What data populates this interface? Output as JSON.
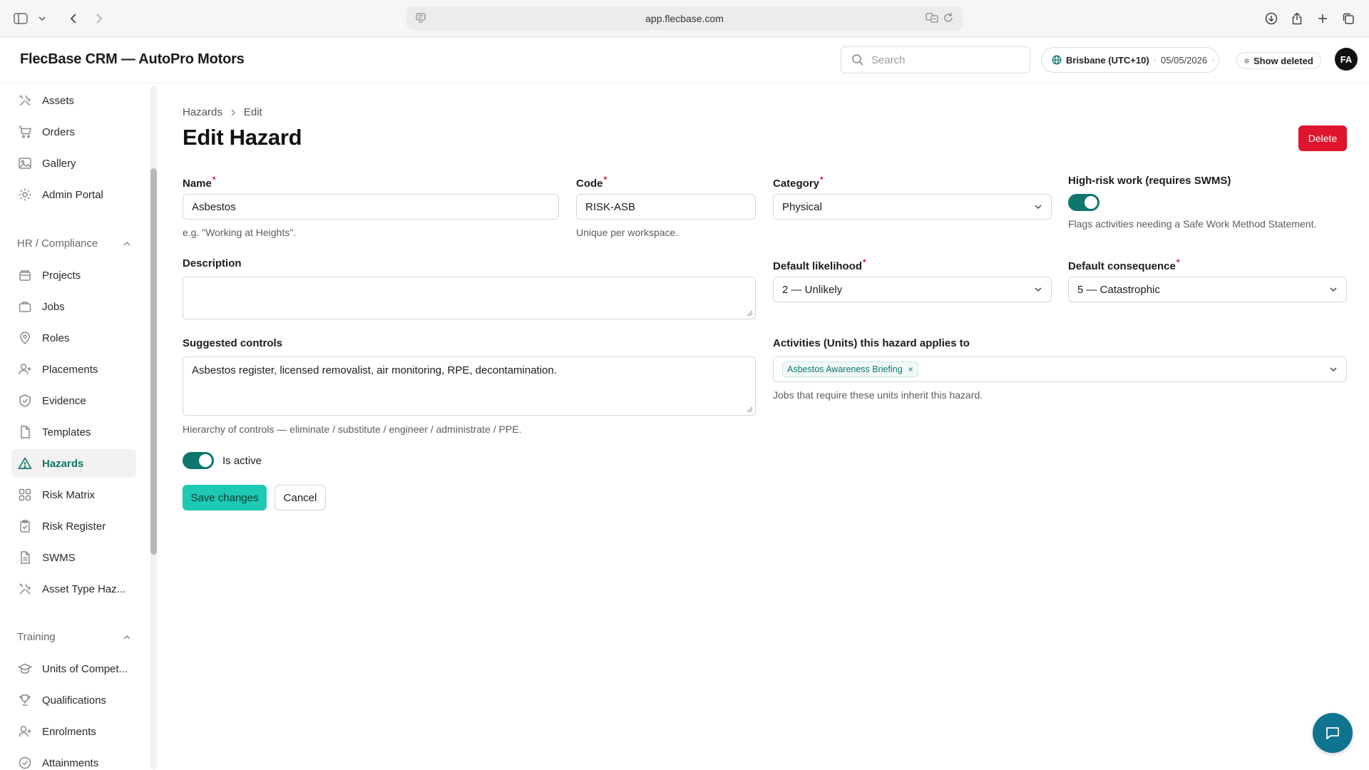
{
  "browser": {
    "url": "app.flecbase.com"
  },
  "header": {
    "app_title": "FlecBase CRM — AutoPro Motors",
    "search_placeholder": "Search",
    "timezone": "Brisbane (UTC+10)",
    "date": "05/05/2026",
    "show_deleted_label": "Show deleted",
    "avatar_initials": "FA"
  },
  "sidebar": {
    "top_items": [
      {
        "label": "Assets",
        "icon": "tools-icon"
      },
      {
        "label": "Orders",
        "icon": "cart-icon"
      },
      {
        "label": "Gallery",
        "icon": "image-icon"
      },
      {
        "label": "Admin Portal",
        "icon": "gear-icon"
      }
    ],
    "hr_group_label": "HR / Compliance",
    "hr_items": [
      {
        "label": "Projects",
        "icon": "folder-icon"
      },
      {
        "label": "Jobs",
        "icon": "briefcase-icon"
      },
      {
        "label": "Roles",
        "icon": "location-pin-icon"
      },
      {
        "label": "Placements",
        "icon": "user-plus-icon"
      },
      {
        "label": "Evidence",
        "icon": "shield-check-icon"
      },
      {
        "label": "Templates",
        "icon": "document-icon"
      },
      {
        "label": "Hazards",
        "icon": "warning-icon"
      },
      {
        "label": "Risk Matrix",
        "icon": "grid-icon"
      },
      {
        "label": "Risk Register",
        "icon": "clipboard-check-icon"
      },
      {
        "label": "SWMS",
        "icon": "file-text-icon"
      },
      {
        "label": "Asset Type Haz...",
        "icon": "tools-icon"
      }
    ],
    "training_group_label": "Training",
    "training_items": [
      {
        "label": "Units of Compet...",
        "icon": "graduation-cap-icon"
      },
      {
        "label": "Qualifications",
        "icon": "trophy-icon"
      },
      {
        "label": "Enrolments",
        "icon": "user-plus-icon"
      },
      {
        "label": "Attainments",
        "icon": "check-circle-icon"
      }
    ],
    "active": "Hazards"
  },
  "main": {
    "breadcrumb": [
      "Hazards",
      "Edit"
    ],
    "title": "Edit Hazard",
    "delete_label": "Delete",
    "fields": {
      "name": {
        "label": "Name",
        "value": "Asbestos",
        "hint": "e.g. \"Working at Heights\"."
      },
      "code": {
        "label": "Code",
        "value": "RISK-ASB",
        "hint": "Unique per workspace."
      },
      "category": {
        "label": "Category",
        "value": "Physical"
      },
      "high_risk": {
        "label": "High-risk work (requires SWMS)",
        "enabled": true,
        "hint": "Flags activities needing a Safe Work Method Statement."
      },
      "description": {
        "label": "Description",
        "value": ""
      },
      "default_likelihood": {
        "label": "Default likelihood",
        "value": "2 — Unlikely"
      },
      "default_consequence": {
        "label": "Default consequence",
        "value": "5 — Catastrophic"
      },
      "suggested_controls": {
        "label": "Suggested controls",
        "value": "Asbestos register, licensed removalist, air monitoring, RPE, decontamination.",
        "hint": "Hierarchy of controls — eliminate / substitute / engineer / administrate / PPE."
      },
      "activities": {
        "label": "Activities (Units) this hazard applies to",
        "chips": [
          "Asbestos Awareness Briefing"
        ],
        "hint": "Jobs that require these units inherit this hazard."
      },
      "is_active": {
        "label": "Is active",
        "enabled": true
      }
    },
    "required_marker": "*",
    "save_label": "Save changes",
    "cancel_label": "Cancel"
  },
  "colors": {
    "accent": "#0f766e",
    "save_button": "#1dc9b2",
    "delete_button": "#e0142b",
    "fab": "#0e7490"
  }
}
